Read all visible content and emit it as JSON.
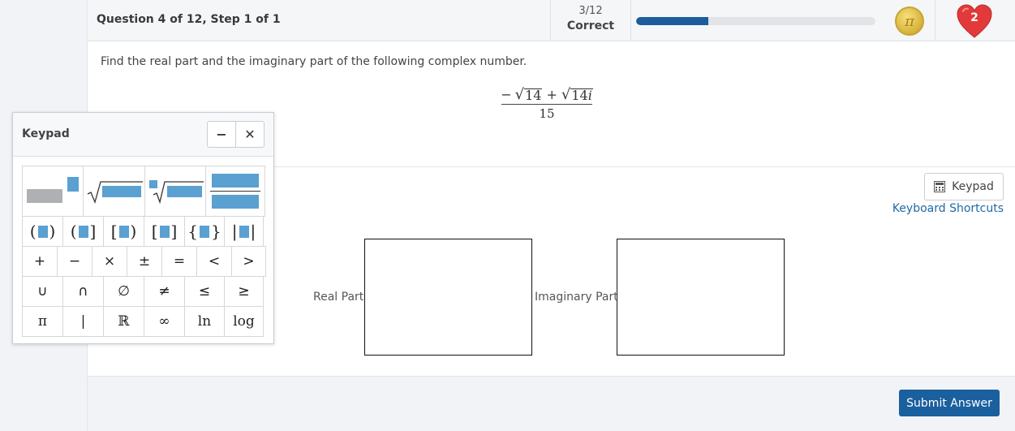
{
  "header": {
    "question_title": "Question 4 of 12, Step 1 of 1",
    "score_count": "3/12",
    "score_label": "Correct",
    "progress": 0.3,
    "coin_symbol": "π",
    "lives": "2"
  },
  "question": {
    "prompt": "Find the real part and the imaginary part of the following complex number.",
    "numerator_sign": "−",
    "radicand_1": "14",
    "plus": "+",
    "radicand_2": "14",
    "imag_unit": "i",
    "denominator": "15"
  },
  "answer": {
    "keypad_button_label": "Keypad",
    "shortcuts_link": "Keyboard Shortcuts",
    "real_label": "Real Part:",
    "imaginary_label": "Imaginary Part:",
    "submit_label": "Submit Answer"
  },
  "keypad": {
    "title": "Keypad",
    "minimize": "−",
    "close": "✕",
    "operators": [
      "+",
      "−",
      "×",
      "±",
      "=",
      "<",
      ">"
    ],
    "sets": [
      "∪",
      "∩",
      "∅",
      "≠",
      "≤",
      "≥"
    ],
    "misc": [
      "π",
      "|",
      "ℝ",
      "∞",
      "ln",
      "log"
    ]
  },
  "colors": {
    "accent": "#1a5f9e",
    "progress_fill": "#1d5d9b",
    "keypad_slot": "#5aa0d0",
    "heart": "#e23a3a"
  }
}
